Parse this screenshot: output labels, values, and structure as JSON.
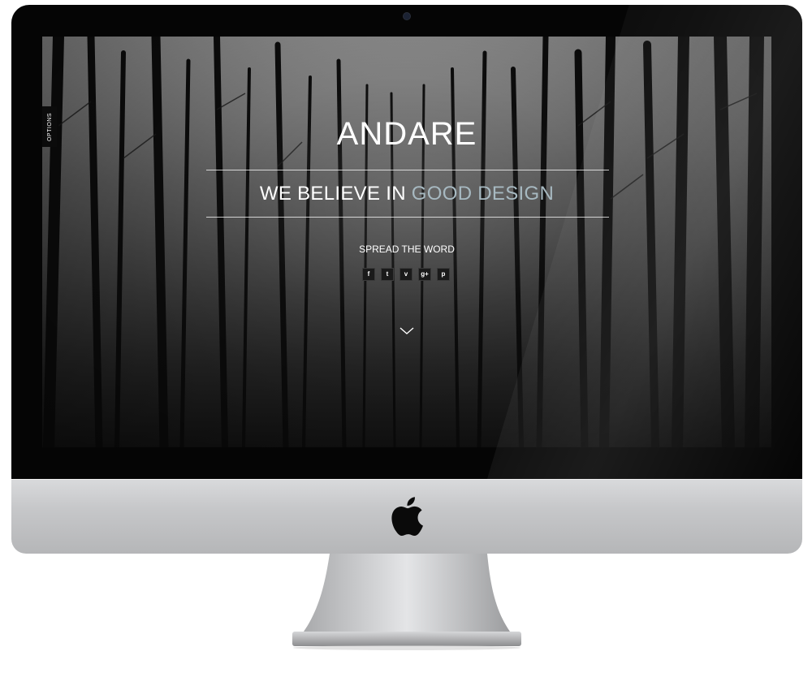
{
  "sidebar": {
    "options_label": "OPTIONS"
  },
  "hero": {
    "brand": "ANDARE",
    "tagline_prefix": "WE BELIEVE IN",
    "tagline_accent": "GOOD DESIGN",
    "spread_label": "SPREAD THE WORD"
  },
  "social": [
    {
      "name": "facebook-icon",
      "glyph": "f"
    },
    {
      "name": "twitter-icon",
      "glyph": "t"
    },
    {
      "name": "vimeo-icon",
      "glyph": "v"
    },
    {
      "name": "google-plus-icon",
      "glyph": "g+"
    },
    {
      "name": "pinterest-icon",
      "glyph": "p"
    }
  ],
  "colors": {
    "accent": "#a7b9c1",
    "text": "#ffffff",
    "bezel": "#050505"
  }
}
